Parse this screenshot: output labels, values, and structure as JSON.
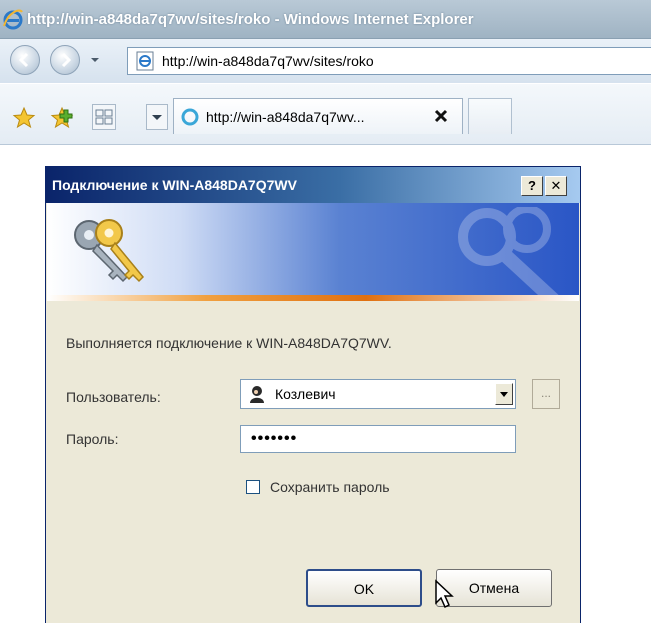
{
  "browser": {
    "window_title": "http://win-a848da7q7wv/sites/roko - Windows Internet Explorer",
    "address": "http://win-a848da7q7wv/sites/roko",
    "tab_title": "http://win-a848da7q7wv...",
    "icons": {
      "logo": "ie-logo-icon",
      "back": "back-arrow-icon",
      "forward": "forward-arrow-icon",
      "favorites": "favorites-star-icon",
      "add_favorite": "add-favorite-icon",
      "quick_tabs": "quick-tabs-icon",
      "tab_close": "close-icon"
    }
  },
  "dialog": {
    "title": "Подключение к WIN-A848DA7Q7WV",
    "help_label": "?",
    "close_label": "✕",
    "message": "Выполняется подключение к WIN-A848DA7Q7WV.",
    "user_label": "Пользователь:",
    "user_value": "Козлевич",
    "password_label": "Пароль:",
    "password_value": "•••••••",
    "remember_label": "Сохранить пароль",
    "remember_checked": false,
    "browse_label": "...",
    "ok_label": "OK",
    "cancel_label": "Отмена"
  },
  "colors": {
    "dialog_title_bg": "#0a246a",
    "dialog_bg": "#ece9d8",
    "browser_title_bg": "#9fb3c3"
  }
}
